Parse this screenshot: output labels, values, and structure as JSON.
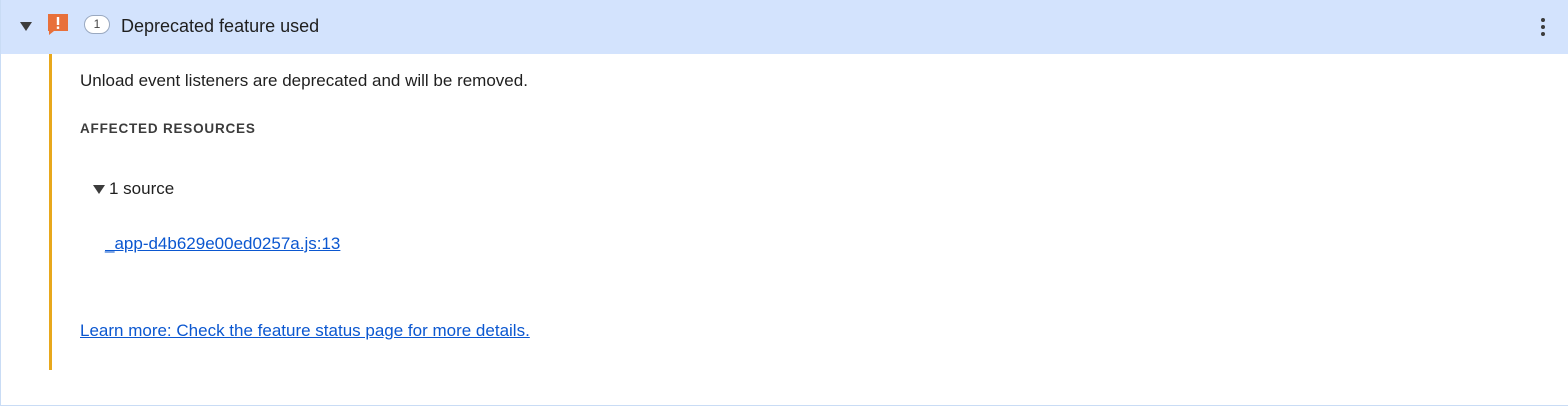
{
  "issue": {
    "count": "1",
    "title": "Deprecated feature used",
    "icon": "warning-exclamation-icon",
    "description": "Unload event listeners are deprecated and will be removed.",
    "affected_heading": "AFFECTED RESOURCES",
    "sources_label": "1 source",
    "sources": [
      "_app-d4b629e00ed0257a.js:13"
    ],
    "learn_more": "Learn more: Check the feature status page for more details."
  },
  "colors": {
    "header_bg": "#d3e3fd",
    "accent_bar": "#e8a81c",
    "warning_icon": "#e8703a",
    "link": "#0b57d0"
  }
}
